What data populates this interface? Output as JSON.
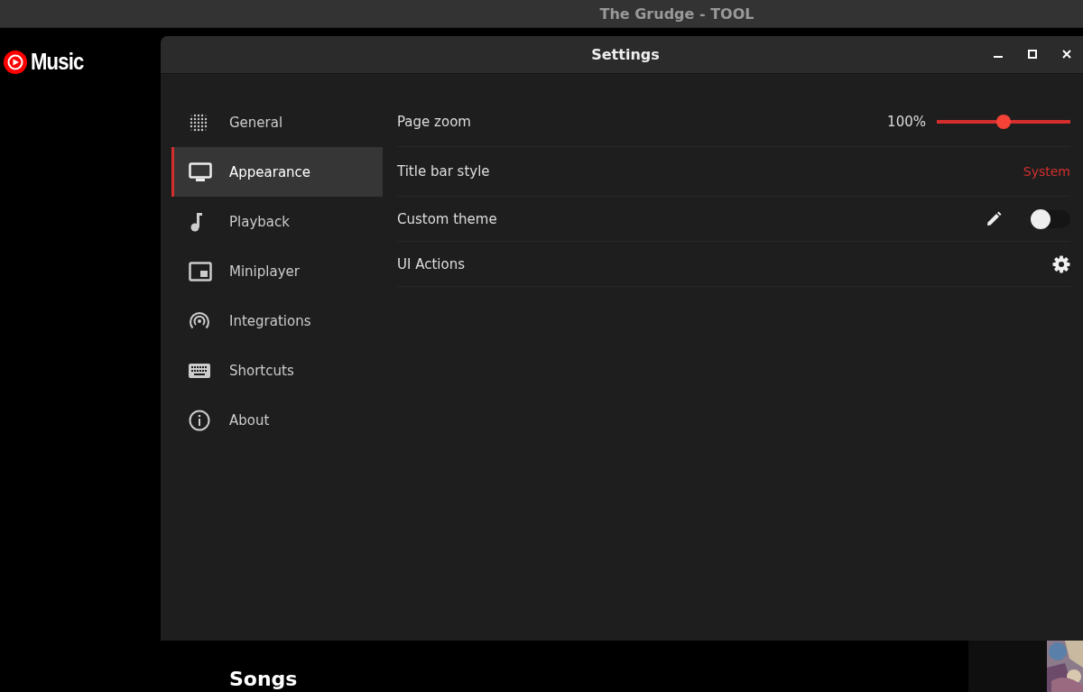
{
  "window": {
    "title": "The Grudge - TOOL"
  },
  "app": {
    "logo_text": "Music",
    "section_heading": "Songs"
  },
  "settings_dialog": {
    "title": "Settings",
    "sidebar": {
      "items": [
        {
          "label": "General",
          "selected": false
        },
        {
          "label": "Appearance",
          "selected": true
        },
        {
          "label": "Playback",
          "selected": false
        },
        {
          "label": "Miniplayer",
          "selected": false
        },
        {
          "label": "Integrations",
          "selected": false
        },
        {
          "label": "Shortcuts",
          "selected": false
        },
        {
          "label": "About",
          "selected": false
        }
      ]
    },
    "rows": [
      {
        "kind": "slider",
        "label": "Page zoom",
        "reading": "100%",
        "level": 0.5
      },
      {
        "kind": "choice",
        "label": "Title bar style",
        "value": "System"
      },
      {
        "kind": "toggle",
        "label": "Custom theme",
        "on": false
      },
      {
        "kind": "gear",
        "label": "UI Actions"
      }
    ]
  }
}
